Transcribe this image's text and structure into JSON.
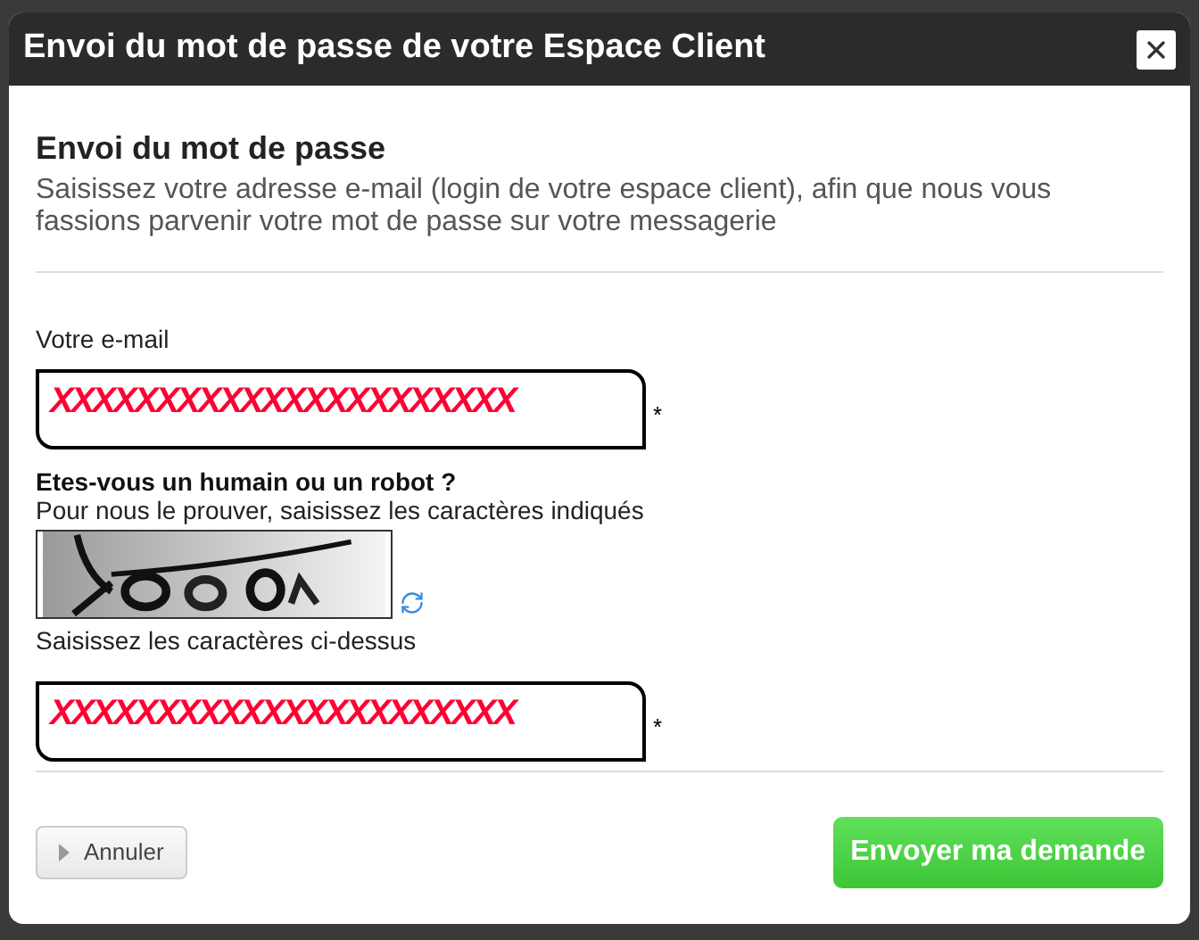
{
  "dialog": {
    "title": "Envoi du mot de passe de votre Espace Client"
  },
  "heading": "Envoi du mot de passe",
  "intro": "Saisissez votre adresse e-mail (login de votre espace client), afin que nous vous fassions parvenir votre mot de passe sur votre messagerie",
  "email": {
    "label": "Votre e-mail",
    "value": "XXXXXXXXXXXXXXXXXXXXXX",
    "required_mark": "*"
  },
  "captcha": {
    "title": "Etes-vous un humain ou un robot ?",
    "hint": "Pour nous le prouver, saisissez les caractères indiqués",
    "label": "Saisissez les caractères ci-dessus",
    "value": "XXXXXXXXXXXXXXXXXXXXXX",
    "required_mark": "*"
  },
  "buttons": {
    "cancel": "Annuler",
    "submit": "Envoyer ma demande"
  }
}
